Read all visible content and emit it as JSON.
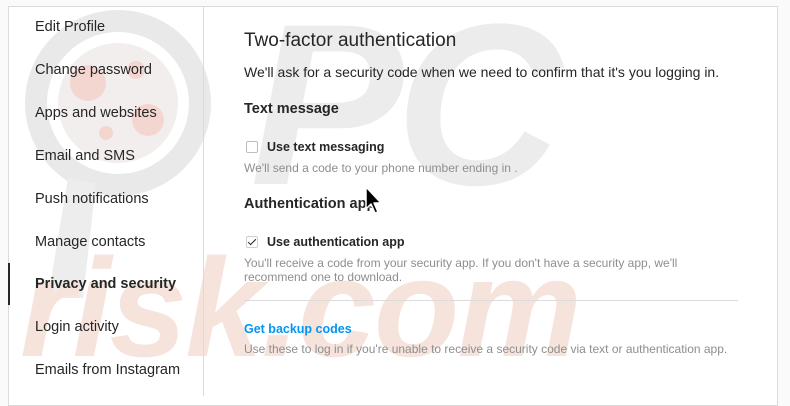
{
  "sidebar": {
    "items": [
      {
        "label": "Edit Profile"
      },
      {
        "label": "Change password"
      },
      {
        "label": "Apps and websites"
      },
      {
        "label": "Email and SMS"
      },
      {
        "label": "Push notifications"
      },
      {
        "label": "Manage contacts"
      },
      {
        "label": "Privacy and security",
        "active": true
      },
      {
        "label": "Login activity"
      },
      {
        "label": "Emails from Instagram"
      }
    ]
  },
  "main": {
    "title": "Two-factor authentication",
    "subtitle": "We'll ask for a security code when we need to confirm that it's you logging in.",
    "text_message": {
      "heading": "Text message",
      "checkbox_label": "Use text messaging",
      "checked": false,
      "helper": "We'll send a code to your phone number ending in ."
    },
    "auth_app": {
      "heading": "Authentication app",
      "checkbox_label": "Use authentication app",
      "checked": true,
      "helper_line1": "You'll receive a code from your security app. If you don't have a security app, we'll",
      "helper_line2": "recommend one to download."
    },
    "backup": {
      "link": "Get backup codes",
      "helper": "Use these to log in if you're unable to receive a security code via text or authentication app."
    }
  },
  "watermark": {
    "letters": "PC",
    "word": "risk.com"
  },
  "colors": {
    "link": "#0095f6",
    "text": "#262626",
    "muted": "#8e8e8e",
    "border": "#dbdbdb"
  }
}
